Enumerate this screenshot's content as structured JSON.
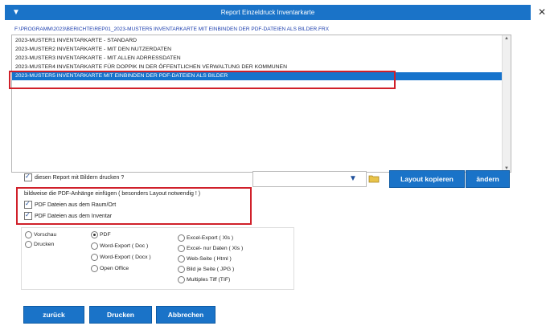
{
  "window": {
    "title": "Report Einzeldruck Inventarkarte",
    "close_glyph": "✕"
  },
  "file_path": "F:\\PROGRAMM\\2023\\BERICHTE\\REP01_2023-MUSTER5 INVENTARKARTE MIT EINBINDEN DER PDF-DATEIEN ALS BILDER.FRX",
  "report_list": {
    "items": [
      {
        "label": "2023-MUSTER1 INVENTARKARTE - STANDARD",
        "selected": false
      },
      {
        "label": "2023-MUSTER2 INVENTARKARTE - MIT DEN NUTZERDATEN",
        "selected": false
      },
      {
        "label": "2023-MUSTER3 INVENTARKARTE - MIT ALLEN ADRRESSDATEN",
        "selected": false
      },
      {
        "label": "2023-MUSTER4 INVENTARKARTE FÜR DOPPIK IN DER ÖFFENTLICHEN VERWALTUNG DER KOMMUNEN",
        "selected": false
      },
      {
        "label": "2023-MUSTER5 INVENTARKARTE MIT EINBINDEN DER PDF-DATEIEN ALS BILDER",
        "selected": true
      }
    ]
  },
  "print_with_images": {
    "label": "diesen Report mit Bildern drucken ?",
    "checked": true
  },
  "layout_buttons": {
    "copy_label": "Layout kopieren",
    "change_label": "ändern"
  },
  "pdf_attach": {
    "heading": "bildweise die PDF-Anhänge einfügen ( besonders Layout notwendig ! )",
    "room_label": "PDF Dateien aus dem Raum/Ort",
    "room_checked": true,
    "inventory_label": "PDF Dateien aus dem Inventar",
    "inventory_checked": true
  },
  "mode": {
    "preview": "Vorschau",
    "print": "Drucken"
  },
  "formats": {
    "col1": [
      "PDF",
      "Word-Export ( Doc )",
      "Word-Export ( Docx )",
      "Open Office"
    ],
    "col2": [
      "Excel-Export ( Xls )",
      "Excel- nur Daten ( Xls )",
      "Web-Seite ( Html )",
      "Bild je Seite ( JPG )",
      "Multiples Tiff (TIF)"
    ],
    "selected": "PDF"
  },
  "footer": {
    "back_label": "zurück",
    "print_label": "Drucken",
    "cancel_label": "Abbrechen"
  },
  "colors": {
    "accent": "#1a73c8",
    "highlight": "#d0202a"
  }
}
